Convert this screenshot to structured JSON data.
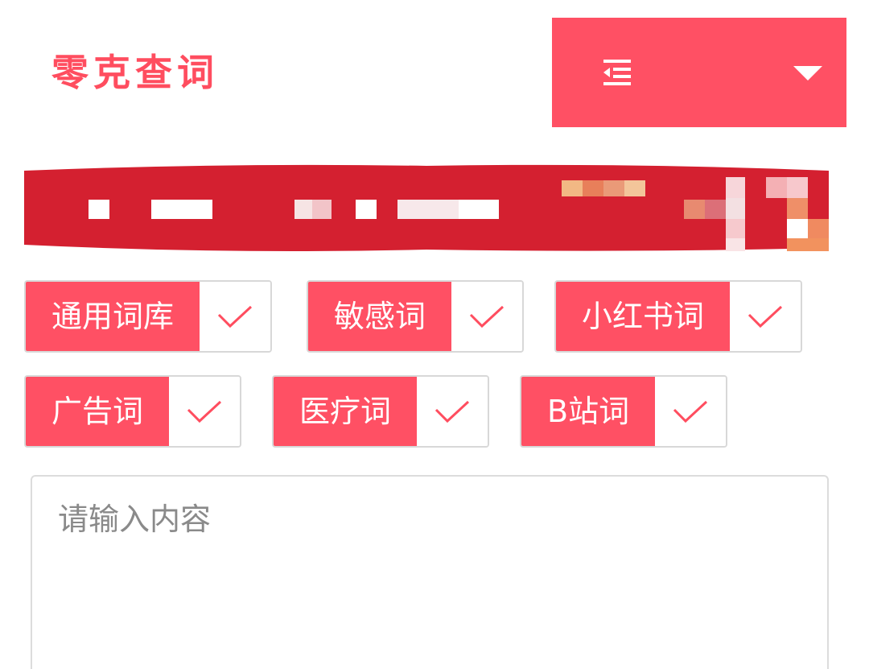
{
  "header": {
    "logo_text": "零克查词",
    "brand_color": "#ff4d5f"
  },
  "menu": {
    "toggle_icon": "indent-menu-icon",
    "dropdown_icon": "caret-down-icon",
    "background": "#ff5064"
  },
  "tags": [
    {
      "label": "通用词库",
      "checked": true
    },
    {
      "label": "敏感词",
      "checked": true
    },
    {
      "label": "小红书词",
      "checked": true
    },
    {
      "label": "广告词",
      "checked": true
    },
    {
      "label": "医疗词",
      "checked": true
    },
    {
      "label": "B站词",
      "checked": true
    }
  ],
  "input": {
    "placeholder": "请输入内容",
    "value": ""
  }
}
